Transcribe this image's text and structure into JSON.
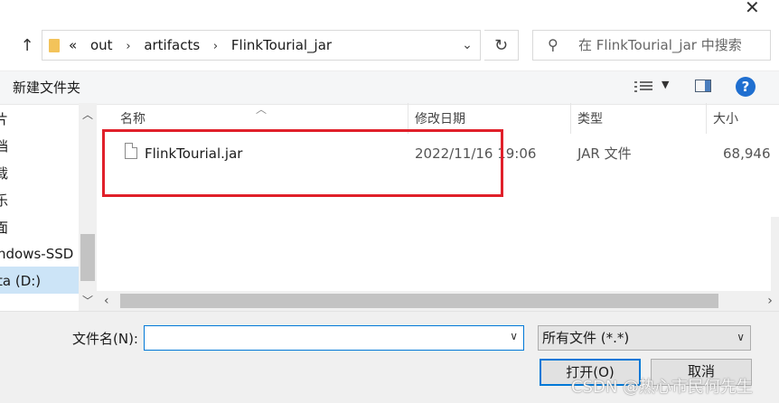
{
  "window": {
    "close_glyph": "✕"
  },
  "address_bar": {
    "overflow_glyph": "«",
    "crumbs": [
      "out",
      "artifacts",
      "FlinkTourial_jar"
    ],
    "separator": "›"
  },
  "search": {
    "placeholder": "在 FlinkTourial_jar 中搜索"
  },
  "toolbar": {
    "new_folder_label": "新建文件夹",
    "help_label": "?"
  },
  "nav_pane": {
    "items": [
      "片",
      "档",
      "载",
      "乐",
      "面",
      "ndows-SSD (",
      "ta (D:)"
    ],
    "selected_index": 6
  },
  "file_list": {
    "columns": {
      "name": "名称",
      "modified": "修改日期",
      "type": "类型",
      "size": "大小"
    },
    "rows": [
      {
        "name": "FlinkTourial.jar",
        "modified": "2022/11/16 19:06",
        "type": "JAR 文件",
        "size": "68,946"
      }
    ]
  },
  "bottom": {
    "filename_label": "文件名(N):",
    "filename_value": "",
    "filetype_value": "所有文件 (*.*)",
    "open_label": "打开(O)",
    "cancel_label": "取消"
  },
  "watermark": "CSDN @热心市民何先生",
  "colors": {
    "accent": "#0078d7",
    "highlight_box": "#e0202a",
    "selection": "#cce4f7"
  }
}
